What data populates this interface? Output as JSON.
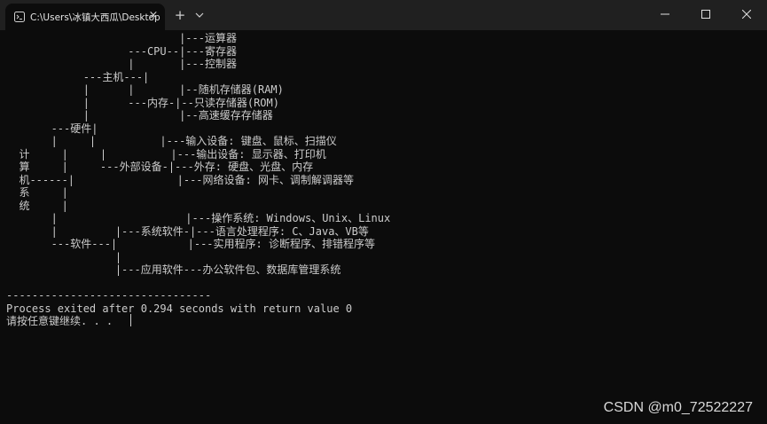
{
  "titlebar": {
    "tab_title": "C:\\Users\\冰镇大西瓜\\Desktop",
    "tab_icon": "terminal-icon",
    "close_tab_glyph": "×",
    "new_tab_glyph": "+",
    "dropdown_icon": "chevron-down-icon",
    "window_controls": [
      "minimize-icon",
      "maximize-icon",
      "close-icon"
    ]
  },
  "console": {
    "lines": [
      "                           |---运算器",
      "                   ---CPU--|---寄存器",
      "                   |       |---控制器",
      "            ---主机---|",
      "            |      |       |--随机存储器(RAM)",
      "            |      ---内存-|--只读存储器(ROM)",
      "            |              |--高速缓存存储器",
      "       ---硬件|",
      "       |     |          |---输入设备: 键盘、鼠标、扫描仪",
      "  计     |     |          |---输出设备: 显示器、打印机",
      "  算     |     ---外部设备-|---外存: 硬盘、光盘、内存",
      "  机------|                |---网络设备: 网卡、调制解调器等",
      "  系     |",
      "  统     |",
      "       |                    |---操作系统: Windows、Unix、Linux",
      "       |         |---系统软件-|---语言处理程序: C、Java、VB等",
      "       ---软件---|           |---实用程序: 诊断程序、排错程序等",
      "                 |",
      "                 |---应用软件---办公软件包、数据库管理系统",
      "",
      "--------------------------------",
      "Process exited after 0.294 seconds with return value 0",
      "请按任意键继续. . ."
    ]
  },
  "watermark": "CSDN @m0_72522227",
  "colors": {
    "background": "#0c0c0c",
    "titlebar": "#202020",
    "text": "#cccccc"
  }
}
